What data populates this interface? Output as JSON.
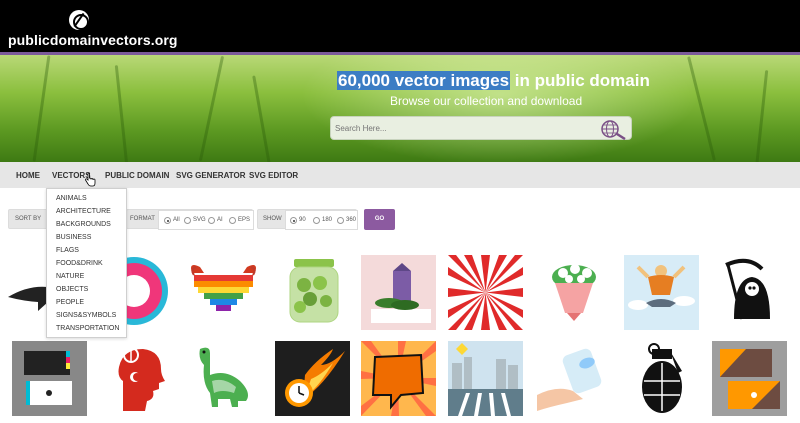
{
  "site": {
    "name": "publicdomainvectors.org"
  },
  "hero": {
    "title_highlight": "60,000 vector images",
    "title_rest": " in public domain",
    "subtitle": "Browse our collection and download",
    "search_placeholder": "Search Here..."
  },
  "nav": {
    "items": [
      "HOME",
      "VECTORS",
      "PUBLIC DOMAIN",
      "SVG GENERATOR",
      "SVG EDITOR"
    ]
  },
  "dropdown": {
    "items": [
      "ANIMALS",
      "ARCHITECTURE",
      "BACKGROUNDS",
      "BUSINESS",
      "FLAGS",
      "FOOD&DRINK",
      "NATURE",
      "OBJECTS",
      "PEOPLE",
      "SIGNS&SYMBOLS",
      "TRANSPORTATION"
    ]
  },
  "filters": {
    "sort_label": "SORT BY",
    "format_label": "FORMAT",
    "format_options": [
      "All",
      "SVG",
      "AI",
      "EPS"
    ],
    "format_selected": "All",
    "show_label": "SHOW",
    "show_options": [
      "90",
      "180",
      "360"
    ],
    "show_selected": "90",
    "go_label": "GO"
  },
  "colors": {
    "accent": "#8c5aa0",
    "topbar": "#000000",
    "highlight": "#3c7dc4"
  },
  "thumbnails": {
    "row1": [
      "shark",
      "pink-ring",
      "rainbow-heart",
      "green-jar",
      "milk-carton-cucumber",
      "red-sunburst",
      "flower-bouquet",
      "meditating-man",
      "grim-reaper"
    ],
    "row2": [
      "business-cards-cmyk",
      "peace-turkey-profile",
      "green-dinosaur",
      "flaming-clock",
      "comic-speech-bubble",
      "pedestrian-crossing",
      "toilet-paper-hand",
      "hand-grenade",
      "orange-business-cards"
    ]
  }
}
